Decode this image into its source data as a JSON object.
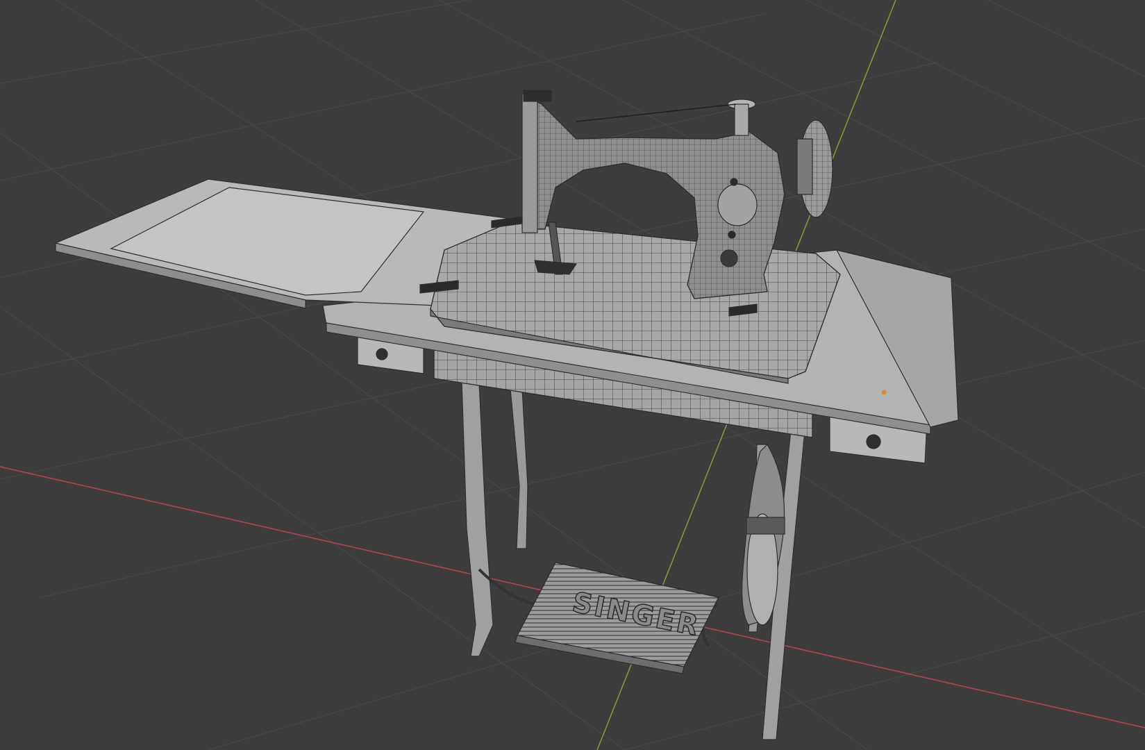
{
  "viewport": {
    "mode": "3d-viewport",
    "shading": "solid-wireframe-overlay",
    "background_color": "#3d3d3d",
    "grid_color": "#4a4a4a",
    "x_axis_color": "#b5424f",
    "y_axis_color": "#7d9a3a"
  },
  "scene": {
    "object": "treadle-sewing-machine",
    "pedal_text": "SINGER",
    "mesh_fill_color": "#a9a9a9",
    "mesh_wire_color": "#2e2e2e",
    "origin_point_color": "#e08a2c"
  }
}
